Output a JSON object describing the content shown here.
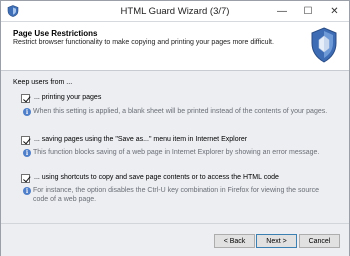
{
  "window": {
    "title": "HTML Guard Wizard (3/7)",
    "controls": {
      "minimize": "—",
      "maximize": "☐",
      "close": "✕"
    }
  },
  "header": {
    "title": "Page Use Restrictions",
    "subtitle": "Restrict browser functionality to make copying and printing your pages more difficult."
  },
  "content": {
    "intro": "Keep users from ...",
    "options": [
      {
        "label": "... printing your pages",
        "checked": true,
        "note": "When this setting is applied, a blank sheet will be printed instead of the contents of your pages."
      },
      {
        "label": "... saving pages using the \"Save as...\" menu item in Internet Explorer",
        "checked": true,
        "note": "This function blocks saving of a web page in Internet Explorer by showing an error message."
      },
      {
        "label": "... using shortcuts to copy and save page contents or to access the HTML code",
        "checked": true,
        "note": "For instance, the option disables the Ctrl-U key combination in Firefox for viewing the source code of a web page."
      }
    ]
  },
  "footer": {
    "back_label": "< Back",
    "next_label": "Next >",
    "cancel_label": "Cancel"
  },
  "icons": {
    "app": "shield-app-icon",
    "header": "shield-icon",
    "info": "info-icon"
  }
}
